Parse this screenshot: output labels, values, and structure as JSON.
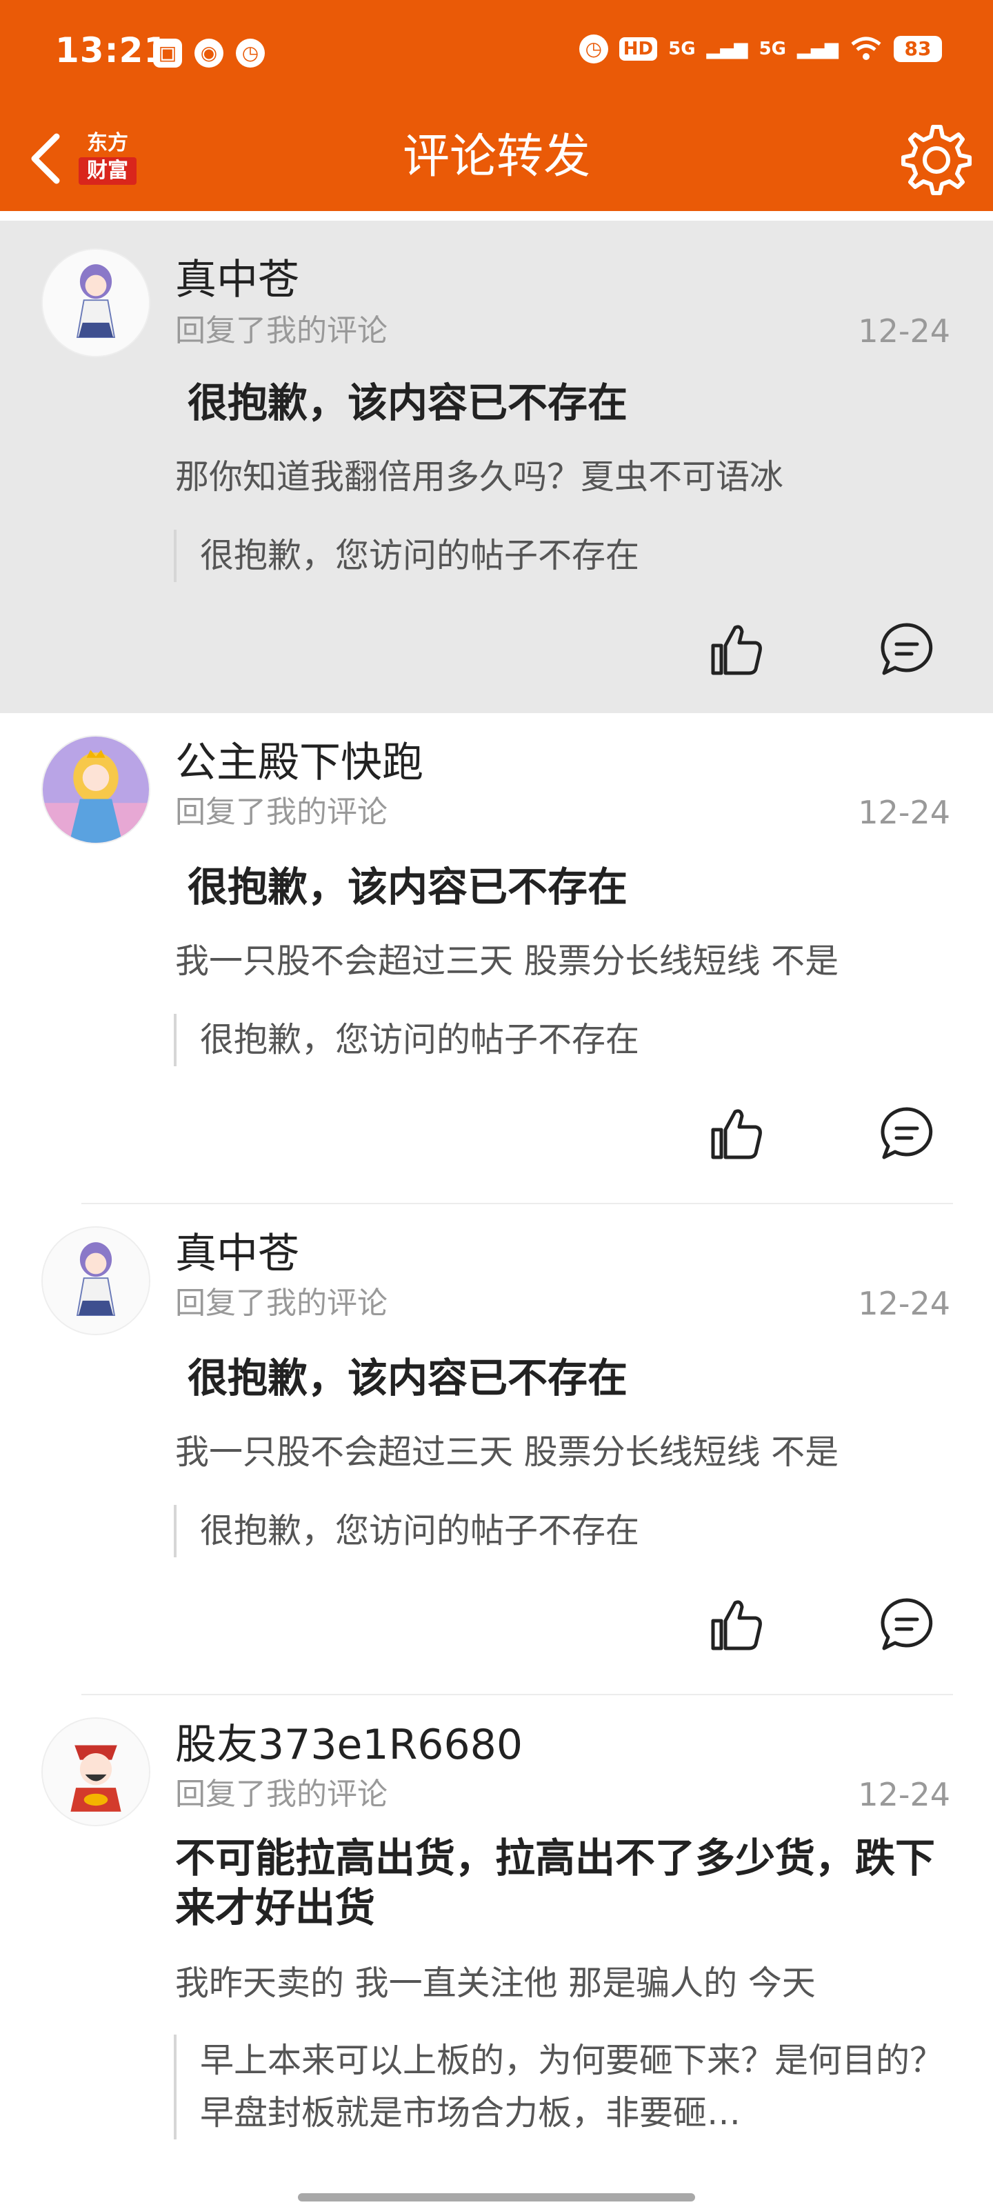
{
  "status_bar": {
    "time": "13:21",
    "network1": "5G",
    "network2": "5G",
    "hd": "HD",
    "battery": "83"
  },
  "nav": {
    "logo_line1": "东方",
    "logo_line2": "财富",
    "title": "评论转发"
  },
  "items": [
    {
      "username": "真中苍",
      "action": "回复了我的评论",
      "date": "12-24",
      "title": "很抱歉，该内容已不存在",
      "reply": "那你知道我翻倍用多久吗？夏虫不可语冰",
      "quote": "很抱歉，您访问的帖子不存在"
    },
    {
      "username": "公主殿下快跑",
      "action": "回复了我的评论",
      "date": "12-24",
      "title": "很抱歉，该内容已不存在",
      "reply": "我一只股不会超过三天   股票分长线短线   不是",
      "quote": "很抱歉，您访问的帖子不存在"
    },
    {
      "username": "真中苍",
      "action": "回复了我的评论",
      "date": "12-24",
      "title": "很抱歉，该内容已不存在",
      "reply": "我一只股不会超过三天   股票分长线短线   不是",
      "quote": "很抱歉，您访问的帖子不存在"
    },
    {
      "username": "股友373e1R6680",
      "action": "回复了我的评论",
      "date": "12-24",
      "title": "不可能拉高出货，拉高出不了多少货，跌下来才好出货",
      "reply": "我昨天卖的  我一直关注他   那是骗人的   今天",
      "quote": "早上本来可以上板的，为何要砸下来？是何目的？早盘封板就是市场合力板，非要砸…"
    }
  ],
  "colors": {
    "brand_orange": "#ea5a07",
    "highlight_bg": "#e8e8e8"
  },
  "icons": [
    "back-arrow-icon",
    "settings-gear-icon",
    "thumbs-up-icon",
    "comment-bubble-icon"
  ]
}
